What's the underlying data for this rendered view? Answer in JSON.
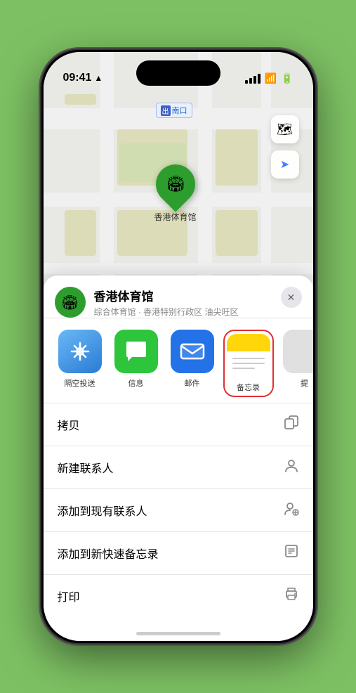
{
  "statusBar": {
    "time": "09:41",
    "locationArrow": "▶"
  },
  "mapLabel": {
    "text": "南口",
    "prefix": "出"
  },
  "mapControls": {
    "mapTypeIcon": "🗺",
    "locationIcon": "➤"
  },
  "stadiumPin": {
    "label": "香港体育馆",
    "emoji": "🏟"
  },
  "bottomSheet": {
    "venueName": "香港体育馆",
    "venueDesc": "综合体育馆 · 香港特别行政区 油尖旺区",
    "closeLabel": "✕"
  },
  "shareItems": [
    {
      "id": "airdrop",
      "label": "隔空投送",
      "type": "airdrop"
    },
    {
      "id": "message",
      "label": "信息",
      "type": "message"
    },
    {
      "id": "mail",
      "label": "邮件",
      "type": "mail"
    },
    {
      "id": "notes",
      "label": "备忘录",
      "type": "notes",
      "selected": true
    },
    {
      "id": "more",
      "label": "提",
      "type": "more"
    }
  ],
  "actionRows": [
    {
      "id": "copy",
      "label": "拷贝",
      "icon": "⎘"
    },
    {
      "id": "new-contact",
      "label": "新建联系人",
      "icon": "👤"
    },
    {
      "id": "add-existing",
      "label": "添加到现有联系人",
      "icon": "👤+"
    },
    {
      "id": "add-notes",
      "label": "添加到新快速备忘录",
      "icon": "📝"
    },
    {
      "id": "print",
      "label": "打印",
      "icon": "🖨"
    }
  ]
}
